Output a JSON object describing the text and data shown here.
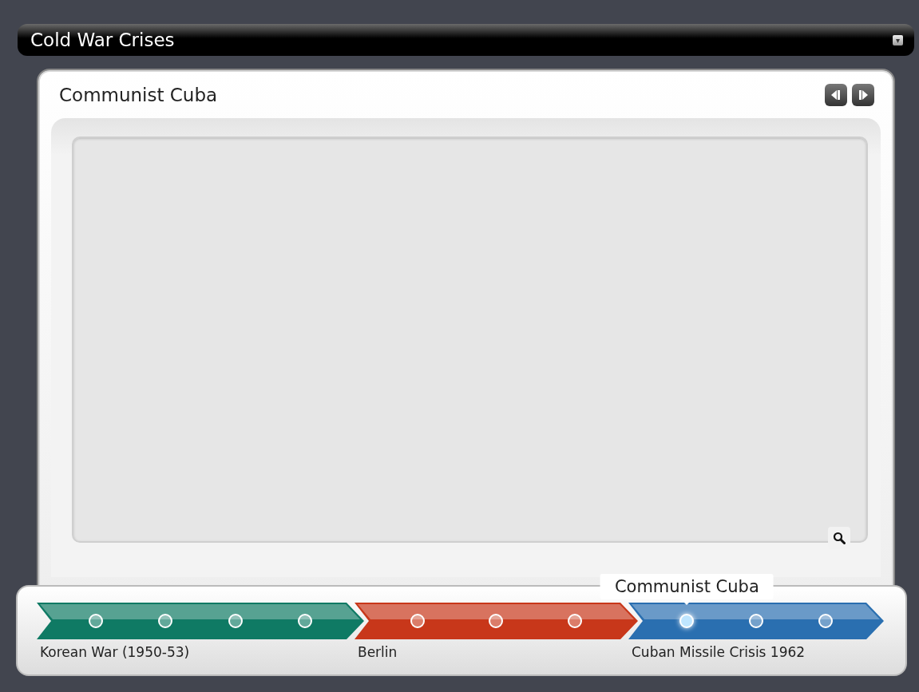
{
  "title_bar": {
    "title": "Cold War Crises",
    "menu_glyph": "▾"
  },
  "panel": {
    "title": "Communist Cuba"
  },
  "timeline": {
    "tooltip": "Communist Cuba",
    "segments": [
      {
        "label": "Korean War (1950-53)",
        "color": "#0f7a64",
        "events": [
          {
            "selected": false
          },
          {
            "selected": false
          },
          {
            "selected": false
          },
          {
            "selected": false
          }
        ]
      },
      {
        "label": "Berlin",
        "color": "#c8371a",
        "events": [
          {
            "selected": false
          },
          {
            "selected": false
          },
          {
            "selected": false
          }
        ]
      },
      {
        "label": "Cuban Missile Crisis 1962",
        "color": "#2a6fb0",
        "events": [
          {
            "selected": true
          },
          {
            "selected": false
          },
          {
            "selected": false
          }
        ]
      }
    ]
  }
}
